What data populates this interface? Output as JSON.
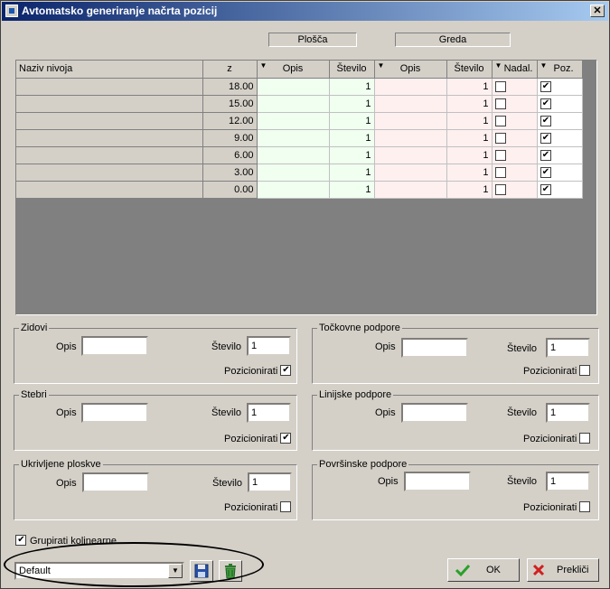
{
  "window": {
    "title": "Avtomatsko generiranje načrta pozicij",
    "close": "✕"
  },
  "groups": {
    "plosca": "Plošča",
    "greda": "Greda"
  },
  "table": {
    "headers": [
      "Naziv nivoja",
      "z",
      "Opis",
      "Število",
      "Opis",
      "Število",
      "Nadal.",
      "Poz."
    ],
    "rows": [
      {
        "z": "18.00",
        "n1": "1",
        "n2": "1",
        "nadal": false,
        "poz": true
      },
      {
        "z": "15.00",
        "n1": "1",
        "n2": "1",
        "nadal": false,
        "poz": true
      },
      {
        "z": "12.00",
        "n1": "1",
        "n2": "1",
        "nadal": false,
        "poz": true
      },
      {
        "z": "9.00",
        "n1": "1",
        "n2": "1",
        "nadal": false,
        "poz": true
      },
      {
        "z": "6.00",
        "n1": "1",
        "n2": "1",
        "nadal": false,
        "poz": true
      },
      {
        "z": "3.00",
        "n1": "1",
        "n2": "1",
        "nadal": false,
        "poz": true
      },
      {
        "z": "0.00",
        "n1": "1",
        "n2": "1",
        "nadal": false,
        "poz": true
      }
    ]
  },
  "labels": {
    "opis": "Opis",
    "stevilo": "Število",
    "pozicionirati": "Pozicionirati"
  },
  "sections": {
    "zidovi": {
      "title": "Zidovi",
      "stevilo": "1",
      "poz": true
    },
    "stebri": {
      "title": "Stebri",
      "stevilo": "1",
      "poz": true
    },
    "ukrivljene": {
      "title": "Ukrivljene ploskve",
      "stevilo": "1",
      "poz": false
    },
    "tockovne": {
      "title": "Točkovne podpore",
      "stevilo": "1",
      "poz": false
    },
    "linijske": {
      "title": "Linijske podpore",
      "stevilo": "1",
      "poz": false
    },
    "povrsinske": {
      "title": "Površinske podpore",
      "stevilo": "1",
      "poz": false
    }
  },
  "grupirati": {
    "label": "Grupirati kolinearne",
    "checked": true
  },
  "preset": {
    "value": "Default"
  },
  "buttons": {
    "ok": "OK",
    "cancel": "Prekliči"
  }
}
